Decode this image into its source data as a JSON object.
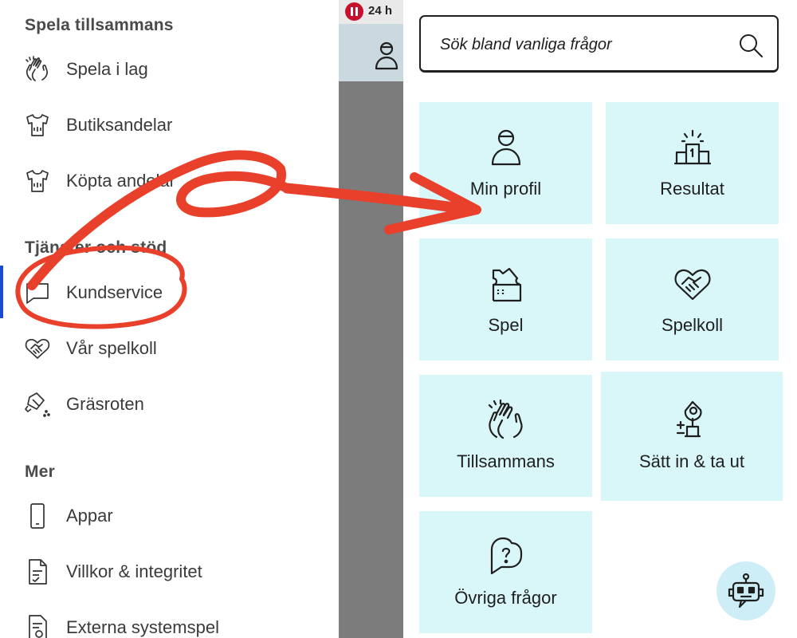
{
  "drawer": {
    "sections": {
      "together": "Spela tillsammans",
      "services": "Tjänster och stöd",
      "more": "Mer"
    },
    "items": [
      {
        "label": "Spela i lag",
        "icon": "clapping-hands-icon"
      },
      {
        "label": "Butiksandelar",
        "icon": "shirt-share-icon"
      },
      {
        "label": "Köpta andelar",
        "icon": "shirt-share-icon"
      },
      {
        "label": "Kundservice",
        "icon": "chat-bubble-icon"
      },
      {
        "label": "Vår spelkoll",
        "icon": "heart-handshake-icon"
      },
      {
        "label": "Gräsroten",
        "icon": "watering-can-icon"
      },
      {
        "label": "Appar",
        "icon": "phone-icon"
      },
      {
        "label": "Villkor & integritet",
        "icon": "document-icon"
      },
      {
        "label": "Externa systemspel",
        "icon": "document-search-icon"
      }
    ]
  },
  "behind": {
    "timer_label": "24 h"
  },
  "help": {
    "search": {
      "placeholder": "Sök bland vanliga frågor"
    },
    "tiles": [
      {
        "label": "Min profil",
        "icon": "person-icon"
      },
      {
        "label": "Resultat",
        "icon": "podium-icon"
      },
      {
        "label": "Spel",
        "icon": "ticket-icon"
      },
      {
        "label": "Spelkoll",
        "icon": "heart-handshake-icon"
      },
      {
        "label": "Tillsammans",
        "icon": "clapping-hands-icon"
      },
      {
        "label": "Sätt in & ta ut",
        "icon": "money-plant-icon"
      },
      {
        "label": "Övriga frågor",
        "icon": "question-bubble-icon"
      }
    ],
    "chatbot": {
      "icon": "robot-icon"
    }
  },
  "colors": {
    "tile_bg": "#d9f6f9",
    "annotation_red": "#e8402a",
    "active_indicator": "#1d4bd6"
  }
}
